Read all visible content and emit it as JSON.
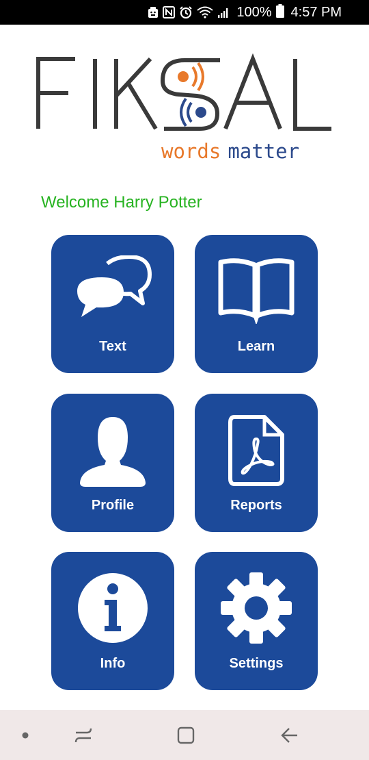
{
  "status_bar": {
    "battery_percent": "100%",
    "time": "4:57 PM",
    "icons": [
      "android-debug-icon",
      "nfc-icon",
      "alarm-icon",
      "wifi-icon",
      "signal-icon",
      "battery-icon"
    ]
  },
  "logo": {
    "brand": "FIKSAL",
    "tagline_word1": "words",
    "tagline_word2": "matter",
    "colors": {
      "dark": "#3a3a3a",
      "orange": "#e8792b",
      "blue": "#2c4a8c"
    }
  },
  "welcome_text": "Welcome Harry Potter",
  "tiles": [
    {
      "label": "Text",
      "icon": "chat-bubbles-icon"
    },
    {
      "label": "Learn",
      "icon": "open-book-icon"
    },
    {
      "label": "Profile",
      "icon": "user-icon"
    },
    {
      "label": "Reports",
      "icon": "pdf-document-icon"
    },
    {
      "label": "Info",
      "icon": "info-icon"
    },
    {
      "label": "Settings",
      "icon": "gear-icon"
    }
  ],
  "colors": {
    "tile_bg": "#1c4a9a",
    "welcome": "#27b321",
    "nav_bg": "#f0e8e8"
  },
  "nav_bar": {
    "buttons": [
      "dot-icon",
      "recents-icon",
      "home-icon",
      "back-icon"
    ]
  }
}
